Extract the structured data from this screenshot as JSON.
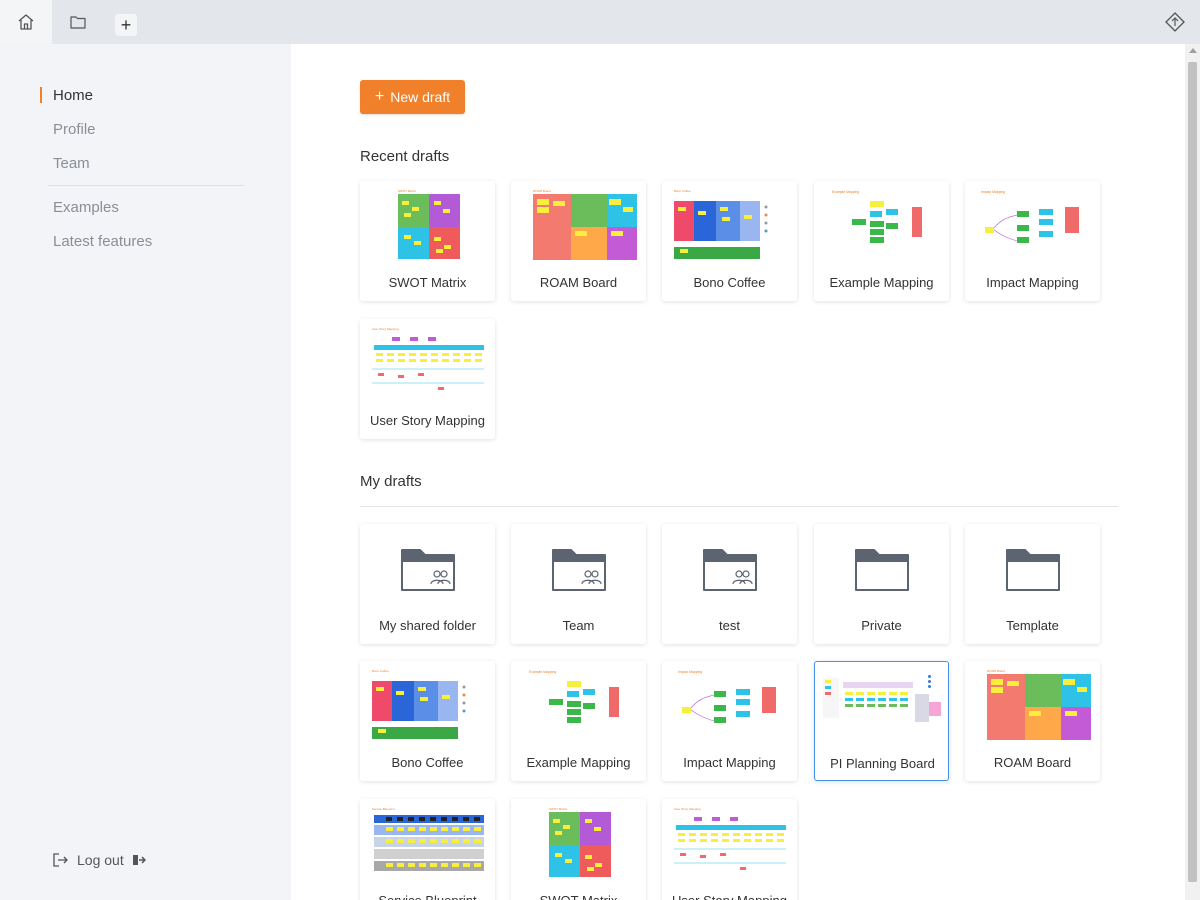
{
  "topbar": {
    "home_icon": "home-icon",
    "folder_icon": "folder-icon",
    "add_tab": "+",
    "logo_icon": "diamond-logo-icon"
  },
  "sidebar": {
    "items": [
      {
        "label": "Home",
        "active": true
      },
      {
        "label": "Profile",
        "active": false
      },
      {
        "label": "Team",
        "active": false
      },
      {
        "label": "Examples",
        "active": false
      },
      {
        "label": "Latest features",
        "active": false
      }
    ],
    "logout_label": "Log out"
  },
  "main": {
    "new_draft_label": "New draft",
    "recent_title": "Recent drafts",
    "my_title": "My drafts",
    "recent": [
      {
        "label": "SWOT Matrix",
        "thumb": "swot"
      },
      {
        "label": "ROAM Board",
        "thumb": "roam"
      },
      {
        "label": "Bono Coffee",
        "thumb": "bono"
      },
      {
        "label": "Example Mapping",
        "thumb": "example"
      },
      {
        "label": "Impact Mapping",
        "thumb": "impact"
      },
      {
        "label": "User Story Mapping",
        "thumb": "usm"
      }
    ],
    "folders": [
      {
        "label": "My shared folder",
        "shared": true
      },
      {
        "label": "Team",
        "shared": true
      },
      {
        "label": "test",
        "shared": true
      },
      {
        "label": "Private",
        "shared": false
      },
      {
        "label": "Template",
        "shared": false
      }
    ],
    "drafts": [
      {
        "label": "Bono Coffee",
        "thumb": "bono"
      },
      {
        "label": "Example Mapping",
        "thumb": "example"
      },
      {
        "label": "Impact Mapping",
        "thumb": "impact"
      },
      {
        "label": "PI Planning Board",
        "thumb": "pi",
        "selected": true
      },
      {
        "label": "ROAM Board",
        "thumb": "roam"
      },
      {
        "label": "Service Blueprint",
        "thumb": "blueprint"
      },
      {
        "label": "SWOT Matrix",
        "thumb": "swot"
      },
      {
        "label": "User Story Mapping",
        "thumb": "usm"
      }
    ]
  },
  "colors": {
    "accent": "#f0812a",
    "selected_border": "#4a8fe7",
    "sidebar_bg": "#f2f4f7",
    "topbar_bg": "#e3e6ea"
  }
}
